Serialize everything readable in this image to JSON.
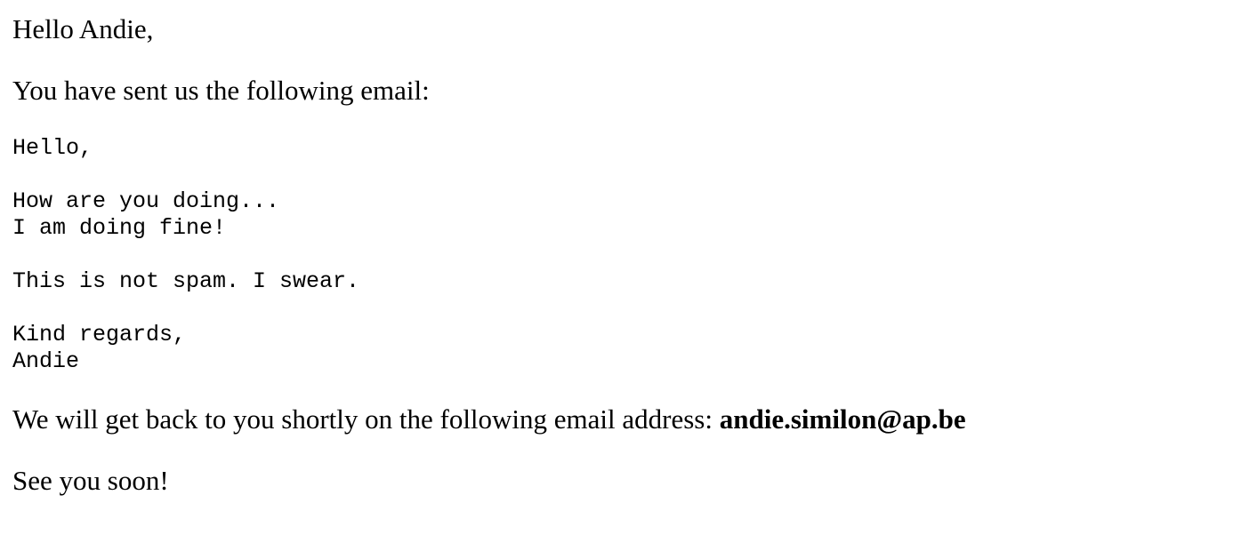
{
  "message": {
    "greeting": "Hello Andie,",
    "intro": "You have sent us the following email:",
    "email_body_lines": [
      "Hello,",
      "",
      "How are you doing...",
      "I am doing fine!",
      "",
      "This is not spam. I swear.",
      "",
      "Kind regards,",
      "Andie"
    ],
    "followup_text": "We will get back to you shortly on the following email address: ",
    "email_address": "andie.similon@ap.be",
    "closing": "See you soon!"
  }
}
